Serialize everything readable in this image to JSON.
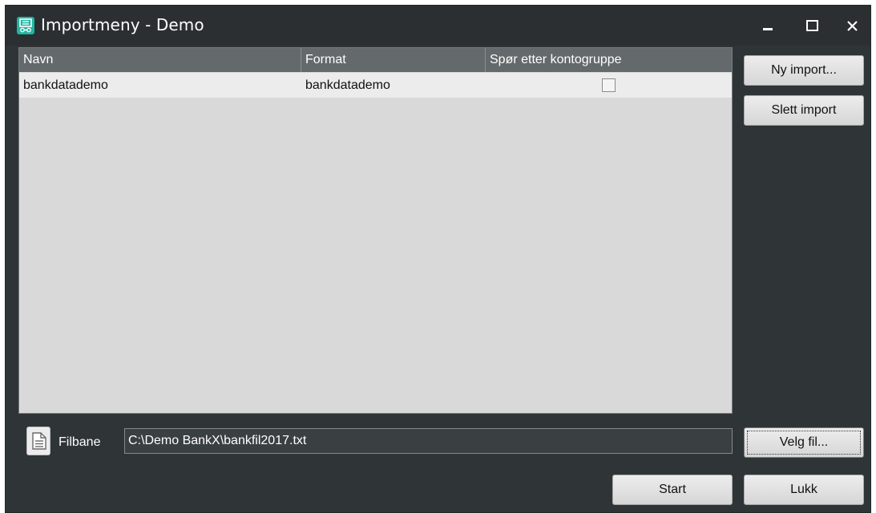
{
  "window": {
    "title": "Importmeny - Demo",
    "icons": {
      "app": "app-logo-icon",
      "minimize": "minimize-icon",
      "maximize": "maximize-icon",
      "close": "close-icon"
    }
  },
  "table": {
    "columns": [
      "Navn",
      "Format",
      "Spør etter kontogruppe"
    ],
    "rows": [
      {
        "navn": "bankdatademo",
        "format": "bankdatademo",
        "spor_etter_kontogruppe": false
      }
    ]
  },
  "buttons": {
    "ny_import": "Ny import...",
    "slett_import": "Slett import",
    "velg_fil": "Velg fil...",
    "start": "Start",
    "lukk": "Lukk"
  },
  "file": {
    "icon": "document-icon",
    "label": "Filbane",
    "path": "C:\\Demo BankX\\bankfil2017.txt"
  },
  "colors": {
    "window_bg": "#2f3436",
    "header_bg": "#64696b",
    "list_bg": "#d9d9d9",
    "accent_icon": "#1fb6a3"
  }
}
